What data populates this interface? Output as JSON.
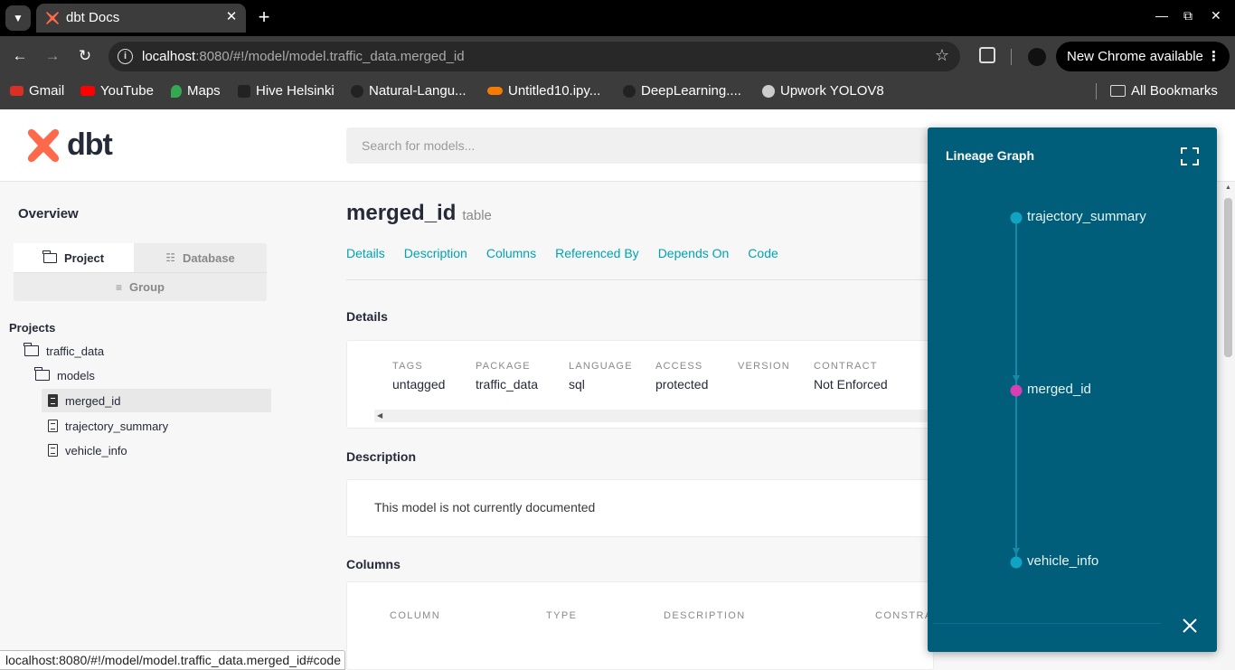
{
  "browser": {
    "tab_title": "dbt Docs",
    "url_host": "localhost",
    "url_rest": ":8080/#!/model/model.traffic_data.merged_id",
    "update_label": "New Chrome available",
    "bookmarks": [
      {
        "label": "Gmail",
        "color": "#d93025"
      },
      {
        "label": "YouTube",
        "color": "#ff0000"
      },
      {
        "label": "Maps",
        "color": "#34a853"
      },
      {
        "label": "Hive Helsinki",
        "color": "#222222"
      },
      {
        "label": "Natural-Langu...",
        "color": "#222222"
      },
      {
        "label": "Untitled10.ipy...",
        "color": "#f57c00"
      },
      {
        "label": "DeepLearning....",
        "color": "#222222"
      },
      {
        "label": "Upwork YOLOV8",
        "color": "#cccccc"
      }
    ],
    "all_bookmarks": "All Bookmarks",
    "status_url": "localhost:8080/#!/model/model.traffic_data.merged_id#code"
  },
  "app": {
    "logo_text": "dbt",
    "brand_color": "#ff694b",
    "search_placeholder": "Search for models..."
  },
  "sidebar": {
    "overview": "Overview",
    "tabs": {
      "project": "Project",
      "database": "Database",
      "group": "Group"
    },
    "projects_label": "Projects",
    "tree": {
      "project": "traffic_data",
      "folder": "models",
      "items": [
        "merged_id",
        "trajectory_summary",
        "vehicle_info"
      ]
    }
  },
  "model": {
    "name": "merged_id",
    "type": "table",
    "subnav": [
      "Details",
      "Description",
      "Columns",
      "Referenced By",
      "Depends On",
      "Code"
    ],
    "details_heading": "Details",
    "details": [
      {
        "key": "TAGS",
        "value": "untagged"
      },
      {
        "key": "PACKAGE",
        "value": "traffic_data"
      },
      {
        "key": "LANGUAGE",
        "value": "sql"
      },
      {
        "key": "ACCESS",
        "value": "protected"
      },
      {
        "key": "VERSION",
        "value": ""
      },
      {
        "key": "CONTRACT",
        "value": "Not Enforced"
      }
    ],
    "description_heading": "Description",
    "description": "This model is not currently documented",
    "columns_heading": "Columns",
    "column_headers": [
      "COLUMN",
      "TYPE",
      "DESCRIPTION",
      "CONSTRA"
    ]
  },
  "lineage": {
    "title": "Lineage Graph",
    "nodes": [
      {
        "name": "trajectory_summary",
        "color": "#11a3c4"
      },
      {
        "name": "merged_id",
        "color": "#d73fb4"
      },
      {
        "name": "vehicle_info",
        "color": "#11a3c4"
      }
    ],
    "edge_color": "#1589a8"
  }
}
